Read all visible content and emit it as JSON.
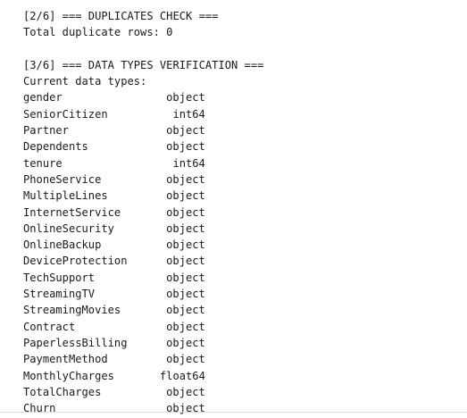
{
  "output": {
    "dup_header": "[2/6] === DUPLICATES CHECK ===",
    "dup_result": "Total duplicate rows: 0",
    "types_header": "[3/6] === DATA TYPES VERIFICATION ===",
    "types_intro": "Current data types:",
    "dtypes": [
      {
        "column": "gender",
        "dtype": "object"
      },
      {
        "column": "SeniorCitizen",
        "dtype": "int64"
      },
      {
        "column": "Partner",
        "dtype": "object"
      },
      {
        "column": "Dependents",
        "dtype": "object"
      },
      {
        "column": "tenure",
        "dtype": "int64"
      },
      {
        "column": "PhoneService",
        "dtype": "object"
      },
      {
        "column": "MultipleLines",
        "dtype": "object"
      },
      {
        "column": "InternetService",
        "dtype": "object"
      },
      {
        "column": "OnlineSecurity",
        "dtype": "object"
      },
      {
        "column": "OnlineBackup",
        "dtype": "object"
      },
      {
        "column": "DeviceProtection",
        "dtype": "object"
      },
      {
        "column": "TechSupport",
        "dtype": "object"
      },
      {
        "column": "StreamingTV",
        "dtype": "object"
      },
      {
        "column": "StreamingMovies",
        "dtype": "object"
      },
      {
        "column": "Contract",
        "dtype": "object"
      },
      {
        "column": "PaperlessBilling",
        "dtype": "object"
      },
      {
        "column": "PaymentMethod",
        "dtype": "object"
      },
      {
        "column": "MonthlyCharges",
        "dtype": "float64"
      },
      {
        "column": "TotalCharges",
        "dtype": "object"
      },
      {
        "column": "Churn",
        "dtype": "object"
      }
    ]
  }
}
